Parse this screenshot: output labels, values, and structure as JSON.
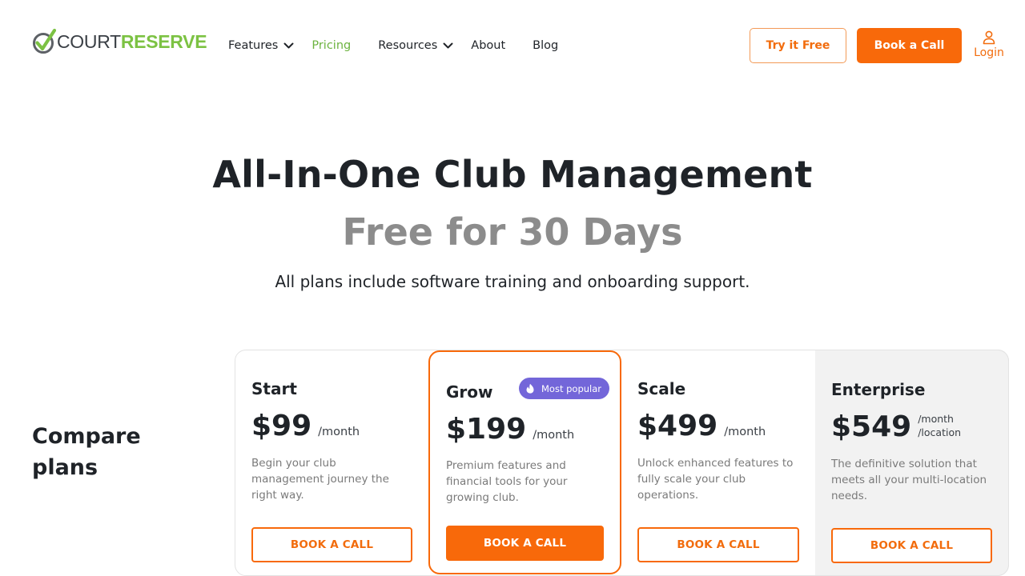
{
  "brand": {
    "name_part1": "COURT",
    "name_part2": "RESERVE",
    "logo_icon": "check-icon"
  },
  "nav": {
    "items": [
      {
        "label": "Features",
        "has_dropdown": true,
        "active": false
      },
      {
        "label": "Pricing",
        "has_dropdown": false,
        "active": true
      },
      {
        "label": "Resources",
        "has_dropdown": true,
        "active": false
      },
      {
        "label": "About",
        "has_dropdown": false,
        "active": false
      },
      {
        "label": "Blog",
        "has_dropdown": false,
        "active": false
      }
    ],
    "try_label": "Try it Free",
    "book_label": "Book a Call",
    "login_label": "Login",
    "login_icon": "user-icon"
  },
  "hero": {
    "title": "All-In-One Club Management",
    "subtitle": "Free for 30 Days",
    "note": "All plans include software training and onboarding support."
  },
  "compare": {
    "line1": "Compare",
    "line2": "plans"
  },
  "plans": [
    {
      "name": "Start",
      "price": "$99",
      "per": "/month",
      "desc": "Begin your club management journey the right way.",
      "cta": "BOOK A CALL"
    },
    {
      "name": "Grow",
      "badge": "Most popular",
      "badge_icon": "flame-icon",
      "price": "$199",
      "per": "/month",
      "desc": "Premium features and financial tools for your growing club.",
      "cta": "BOOK A CALL"
    },
    {
      "name": "Scale",
      "price": "$499",
      "per": "/month",
      "desc": "Unlock enhanced features to fully scale your club operations.",
      "cta": "BOOK A CALL"
    },
    {
      "name": "Enterprise",
      "price": "$549",
      "per": "/month",
      "per2": "/location",
      "desc": "The definitive solution that meets all your multi-location needs.",
      "cta": "BOOK A CALL"
    }
  ],
  "colors": {
    "accent": "#f8690a",
    "brand_green": "#7cc243",
    "badge": "#7366d9",
    "muted_heading": "#8c8c8c"
  }
}
